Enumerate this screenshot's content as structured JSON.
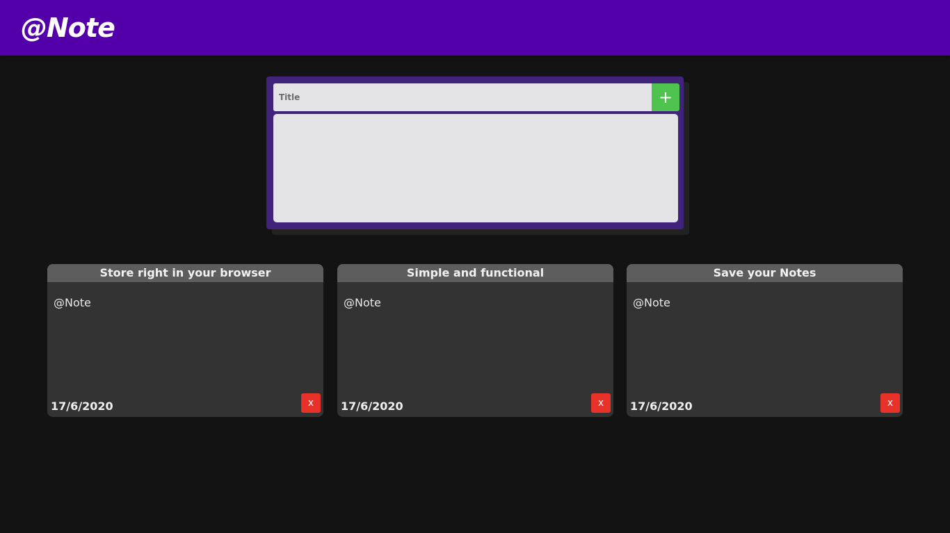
{
  "app": {
    "logo": "@Note"
  },
  "editor": {
    "title_placeholder": "Title",
    "add_label": "+",
    "body_value": ""
  },
  "notes": [
    {
      "title": "Store right in your browser",
      "body": "@Note",
      "date": "17/6/2020",
      "delete_label": "x"
    },
    {
      "title": "Simple and functional",
      "body": "@Note",
      "date": "17/6/2020",
      "delete_label": "x"
    },
    {
      "title": "Save your Notes",
      "body": "@Note",
      "date": "17/6/2020",
      "delete_label": "x"
    }
  ],
  "colors": {
    "topbar": "#5300ab",
    "editor_frame": "#42237c",
    "add_button": "#4ec34e",
    "delete_button": "#e83229",
    "note_header": "#5d5d5d",
    "note_body": "#333333",
    "background": "#131313"
  }
}
